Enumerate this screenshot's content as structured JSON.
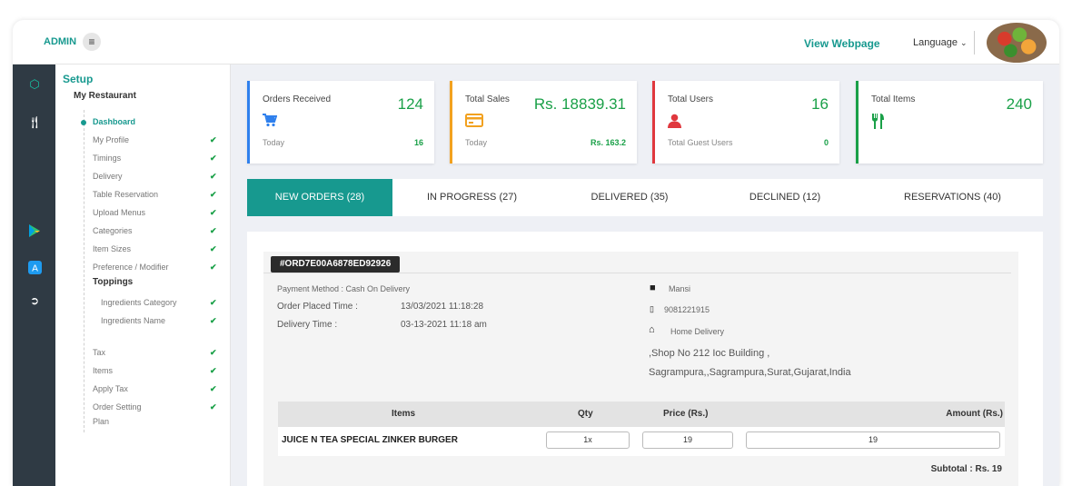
{
  "header": {
    "admin_label": "ADMIN",
    "menu_icon": "hamburger-icon",
    "view_webpage": "View Webpage",
    "language": "Language"
  },
  "sidebar_icons": [
    "cube-icon",
    "cutlery-icon",
    "play-store-icon",
    "app-store-icon",
    "logout-icon"
  ],
  "menu": {
    "setup": "Setup",
    "restaurant": "My Restaurant",
    "items": [
      {
        "label": "Dashboard"
      },
      {
        "label": "My Profile"
      },
      {
        "label": "Timings"
      },
      {
        "label": "Delivery"
      },
      {
        "label": "Table Reservation"
      },
      {
        "label": "Upload Menus"
      },
      {
        "label": "Categories"
      },
      {
        "label": "Item Sizes"
      },
      {
        "label": "Preference / Modifier"
      },
      {
        "label": "Toppings"
      },
      {
        "label": "Ingredients Category"
      },
      {
        "label": "Ingredients Name"
      },
      {
        "label": "Tax"
      },
      {
        "label": "Items"
      },
      {
        "label": "Apply Tax"
      },
      {
        "label": "Order Setting"
      },
      {
        "label": "Plan"
      }
    ],
    "check": "✔"
  },
  "stats": [
    {
      "label": "Orders Received",
      "value": "124",
      "icon": "cart-icon",
      "sub_label": "Today",
      "sub_value": "16",
      "color": "#2f80ed"
    },
    {
      "label": "Total Sales",
      "value": "Rs. 18839.31",
      "icon": "credit-card-icon",
      "sub_label": "Today",
      "sub_value": "Rs. 163.2",
      "color": "#f2a11f"
    },
    {
      "label": "Total Users",
      "value": "16",
      "icon": "user-icon",
      "sub_label": "Total Guest Users",
      "sub_value": "0",
      "color": "#e0383e"
    },
    {
      "label": "Total Items",
      "value": "240",
      "icon": "cutlery-icon",
      "sub_label": "",
      "sub_value": "",
      "color": "#1aa048"
    }
  ],
  "tabs": [
    {
      "label": "NEW ORDERS (28)"
    },
    {
      "label": "IN PROGRESS (27)"
    },
    {
      "label": "DELIVERED (35)"
    },
    {
      "label": "DECLINED (12)"
    },
    {
      "label": "RESERVATIONS (40)"
    }
  ],
  "order": {
    "id": "#ORD7E00A6878ED92926",
    "payment": "Payment Method : Cash On Delivery",
    "placed_label": "Order Placed Time :",
    "placed_value": "13/03/2021 11:18:28",
    "delivery_label": "Delivery Time :",
    "delivery_value": "03-13-2021 11:18 am",
    "customer": "Mansi",
    "phone": "9081221915",
    "delivery_type": "Home Delivery",
    "address1": ",Shop No 212 Ioc Building ,",
    "address2": "Sagrampura,,Sagrampura,Surat,Gujarat,India",
    "columns": {
      "items": "Items",
      "qty": "Qty",
      "price": "Price (Rs.)",
      "amount": "Amount (Rs.)"
    },
    "line": {
      "name": "JUICE N TEA SPECIAL ZINKER BURGER",
      "qty": "1x",
      "price": "19",
      "amount": "19"
    },
    "subtotal": "Subtotal : Rs. 19"
  }
}
